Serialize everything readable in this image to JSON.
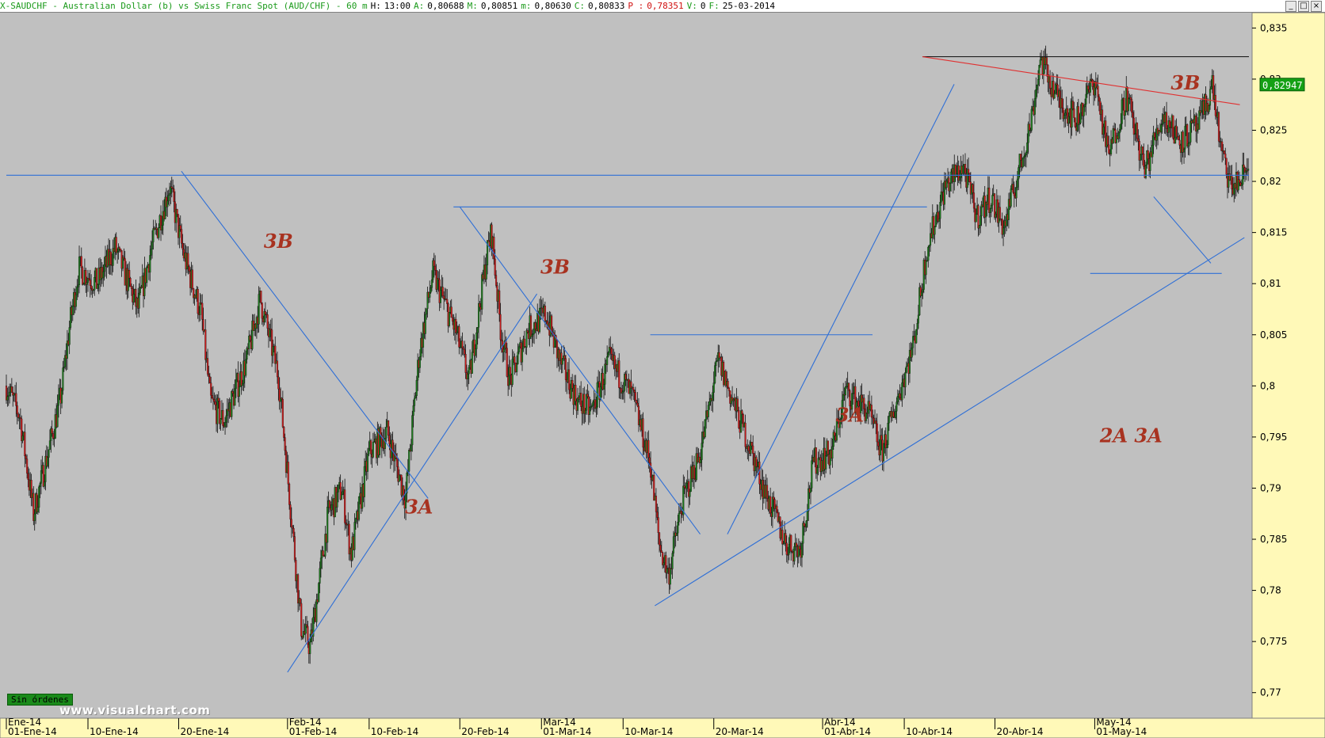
{
  "window": {
    "title_parts": [
      {
        "text": "X-SAUDCHF - Australian Dollar (b) vs Swiss Franc Spot (AUD/CHF) -  60 m",
        "color": "green"
      },
      {
        "text": "H:",
        "color": "black"
      },
      {
        "text": "13:00",
        "color": "black"
      },
      {
        "text": "A:",
        "color": "green"
      },
      {
        "text": "0,80688",
        "color": "black"
      },
      {
        "text": "M:",
        "color": "green"
      },
      {
        "text": "0,80851",
        "color": "black"
      },
      {
        "text": "m:",
        "color": "green"
      },
      {
        "text": "0,80630",
        "color": "black"
      },
      {
        "text": "C:",
        "color": "green"
      },
      {
        "text": "0,80833",
        "color": "black"
      },
      {
        "text": "P :",
        "color": "red"
      },
      {
        "text": "0,78351",
        "color": "red"
      },
      {
        "text": "V:",
        "color": "green"
      },
      {
        "text": "0",
        "color": "black"
      },
      {
        "text": "F:",
        "color": "green"
      },
      {
        "text": "25-03-2014",
        "color": "black"
      }
    ],
    "buttons": [
      "_",
      "□",
      "×"
    ]
  },
  "status_badge": "Sin órdenes",
  "watermark": "www.visualchart.com",
  "colors": {
    "background": "#c0c0c0",
    "candle_up": "#1f7a1f",
    "candle_down": "#c81e1e",
    "trendline": "#2f6fd6",
    "resistance_line": "#e03030",
    "annotation": "#a83220",
    "axis_panel": "#fff9b8",
    "last_price_tag": "#14a014"
  },
  "chart_data": {
    "type": "candlestick",
    "symbol": "X-SAUDCHF",
    "timeframe": "60 m",
    "ylim": [
      0.7675,
      0.8365
    ],
    "yticks": [
      0.77,
      0.775,
      0.78,
      0.785,
      0.79,
      0.795,
      0.8,
      0.805,
      0.81,
      0.815,
      0.82,
      0.825,
      0.83,
      0.835
    ],
    "ytick_labels": [
      "0,77",
      "0,775",
      "0,78",
      "0,785",
      "0,79",
      "0,795",
      "0,8",
      "0,805",
      "0,81",
      "0,815",
      "0,82",
      "0,825",
      "0,83",
      "0,835"
    ],
    "x_day_range": [
      0,
      137
    ],
    "xticks": [
      {
        "day": 0,
        "label": "01-Ene-14"
      },
      {
        "day": 9,
        "label": "10-Ene-14"
      },
      {
        "day": 19,
        "label": "20-Ene-14"
      },
      {
        "day": 31,
        "label": "01-Feb-14"
      },
      {
        "day": 40,
        "label": "10-Feb-14"
      },
      {
        "day": 50,
        "label": "20-Feb-14"
      },
      {
        "day": 59,
        "label": "01-Mar-14"
      },
      {
        "day": 68,
        "label": "10-Mar-14"
      },
      {
        "day": 78,
        "label": "20-Mar-14"
      },
      {
        "day": 90,
        "label": "01-Abr-14"
      },
      {
        "day": 99,
        "label": "10-Abr-14"
      },
      {
        "day": 109,
        "label": "20-Abr-14"
      },
      {
        "day": 120,
        "label": "01-May-14"
      }
    ],
    "month_labels": [
      {
        "day": 0,
        "label": "Ene-14"
      },
      {
        "day": 31,
        "label": "Feb-14"
      },
      {
        "day": 59,
        "label": "Mar-14"
      },
      {
        "day": 90,
        "label": "Abr-14"
      },
      {
        "day": 120,
        "label": "May-14"
      }
    ],
    "price_path": [
      [
        0.0,
        0.8
      ],
      [
        1.5,
        0.797
      ],
      [
        3.0,
        0.7875
      ],
      [
        5.0,
        0.795
      ],
      [
        6.0,
        0.799
      ],
      [
        7.0,
        0.806
      ],
      [
        8.0,
        0.8115
      ],
      [
        10.0,
        0.81
      ],
      [
        12.0,
        0.8135
      ],
      [
        14.5,
        0.8075
      ],
      [
        16.0,
        0.8135
      ],
      [
        18.0,
        0.8195
      ],
      [
        19.5,
        0.813
      ],
      [
        21.5,
        0.807
      ],
      [
        22.5,
        0.7985
      ],
      [
        24.0,
        0.7965
      ],
      [
        26.5,
        0.8025
      ],
      [
        28.0,
        0.8085
      ],
      [
        30.0,
        0.801
      ],
      [
        31.5,
        0.7865
      ],
      [
        32.5,
        0.7765
      ],
      [
        33.5,
        0.7745
      ],
      [
        35.5,
        0.7875
      ],
      [
        37.0,
        0.79
      ],
      [
        38.0,
        0.7835
      ],
      [
        40.0,
        0.7935
      ],
      [
        42.0,
        0.7955
      ],
      [
        44.0,
        0.789
      ],
      [
        45.5,
        0.803
      ],
      [
        47.0,
        0.811
      ],
      [
        49.5,
        0.8055
      ],
      [
        51.0,
        0.8005
      ],
      [
        53.0,
        0.813
      ],
      [
        53.5,
        0.815
      ],
      [
        54.5,
        0.8055
      ],
      [
        55.5,
        0.8005
      ],
      [
        57.5,
        0.8055
      ],
      [
        59.5,
        0.807
      ],
      [
        61.0,
        0.8025
      ],
      [
        63.0,
        0.7985
      ],
      [
        64.5,
        0.7975
      ],
      [
        66.5,
        0.8025
      ],
      [
        69.0,
        0.799
      ],
      [
        71.0,
        0.7925
      ],
      [
        72.0,
        0.7845
      ],
      [
        73.0,
        0.7815
      ],
      [
        74.5,
        0.7885
      ],
      [
        76.5,
        0.7935
      ],
      [
        78.5,
        0.8025
      ],
      [
        80.5,
        0.7975
      ],
      [
        82.0,
        0.794
      ],
      [
        83.5,
        0.79
      ],
      [
        86.0,
        0.7845
      ],
      [
        87.5,
        0.784
      ],
      [
        89.0,
        0.7925
      ],
      [
        91.0,
        0.7935
      ],
      [
        92.5,
        0.7995
      ],
      [
        95.0,
        0.7975
      ],
      [
        96.5,
        0.7935
      ],
      [
        98.5,
        0.7995
      ],
      [
        100.0,
        0.804
      ],
      [
        101.5,
        0.8135
      ],
      [
        103.5,
        0.8195
      ],
      [
        105.5,
        0.8215
      ],
      [
        107.0,
        0.8165
      ],
      [
        108.5,
        0.8185
      ],
      [
        110.0,
        0.8155
      ],
      [
        111.5,
        0.8205
      ],
      [
        113.0,
        0.826
      ],
      [
        114.0,
        0.832
      ],
      [
        116.0,
        0.828
      ],
      [
        118.0,
        0.826
      ],
      [
        120.0,
        0.83
      ],
      [
        121.5,
        0.8225
      ],
      [
        123.5,
        0.8285
      ],
      [
        125.5,
        0.821
      ],
      [
        127.5,
        0.8265
      ],
      [
        129.5,
        0.824
      ],
      [
        131.5,
        0.8255
      ],
      [
        133.0,
        0.8295
      ],
      [
        134.0,
        0.8225
      ],
      [
        135.0,
        0.8195
      ],
      [
        136.0,
        0.82
      ],
      [
        137.0,
        0.8215
      ]
    ],
    "last_price": 0.82947,
    "last_price_label": "0,82947",
    "trendlines": [
      {
        "color": "blue",
        "from": [
          0,
          0.8206
        ],
        "to": [
          137,
          0.8206
        ]
      },
      {
        "color": "blue",
        "from": [
          19.3,
          0.821
        ],
        "to": [
          46.5,
          0.789
        ]
      },
      {
        "color": "blue",
        "from": [
          31,
          0.772
        ],
        "to": [
          58.5,
          0.809
        ]
      },
      {
        "color": "blue",
        "from": [
          49.3,
          0.8175
        ],
        "to": [
          101.5,
          0.8175
        ]
      },
      {
        "color": "blue",
        "from": [
          50.0,
          0.8175
        ],
        "to": [
          76.5,
          0.7855
        ]
      },
      {
        "color": "blue",
        "from": [
          71,
          0.805
        ],
        "to": [
          95.5,
          0.805
        ]
      },
      {
        "color": "blue",
        "from": [
          71.5,
          0.7785
        ],
        "to": [
          136.5,
          0.8145
        ]
      },
      {
        "color": "blue",
        "from": [
          79.5,
          0.7855
        ],
        "to": [
          104.5,
          0.8295
        ]
      },
      {
        "color": "blue",
        "from": [
          119.5,
          0.811
        ],
        "to": [
          134,
          0.811
        ]
      },
      {
        "color": "blue",
        "from": [
          126.5,
          0.8185
        ],
        "to": [
          132.8,
          0.812
        ]
      },
      {
        "color": "black",
        "from": [
          101,
          0.8322
        ],
        "to": [
          137,
          0.8322
        ]
      },
      {
        "color": "red",
        "from": [
          101,
          0.8322
        ],
        "to": [
          136,
          0.8275
        ]
      }
    ],
    "annotations": [
      {
        "text": "3B",
        "day": 30.0,
        "value": 0.8135
      },
      {
        "text": "3A",
        "day": 45.5,
        "value": 0.7875
      },
      {
        "text": "3B",
        "day": 60.5,
        "value": 0.811
      },
      {
        "text": "3A",
        "day": 93.0,
        "value": 0.7965
      },
      {
        "text": "3B",
        "day": 130.0,
        "value": 0.829
      },
      {
        "text": "2A  3A",
        "day": 124.0,
        "value": 0.7945
      }
    ]
  }
}
